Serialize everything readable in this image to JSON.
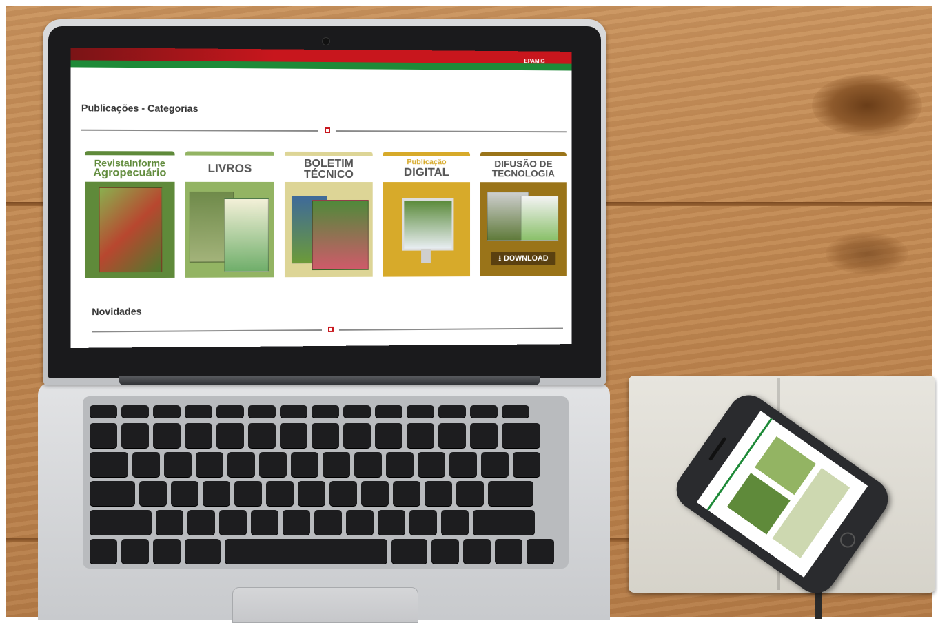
{
  "laptop_site": {
    "brand": "EPAMIG",
    "categories_title": "Publicações - Categorias",
    "news_title": "Novidades",
    "cards": [
      {
        "title_line1": "RevistaInforme",
        "title_line2": "Agropecuário",
        "color": "#5f8a3a"
      },
      {
        "title_line1": "LIVROS",
        "title_line2": "",
        "color": "#93b463"
      },
      {
        "title_line1": "BOLETIM",
        "title_line2": "TÉCNICO",
        "color": "#ddd596"
      },
      {
        "title_line1": "Publicação",
        "title_line2": "DIGITAL",
        "color": "#d7aa2a"
      },
      {
        "title_line1": "DIFUSÃO DE",
        "title_line2": "TECNOLOGIA",
        "color": "#9a7419",
        "button": "DOWNLOAD"
      }
    ]
  },
  "colors": {
    "brand_red": "#c8161d",
    "brand_green": "#1e8a38",
    "wood": "#c08852"
  },
  "icons": [
    "camera-icon",
    "download-icon",
    "phone-home-button-icon"
  ]
}
